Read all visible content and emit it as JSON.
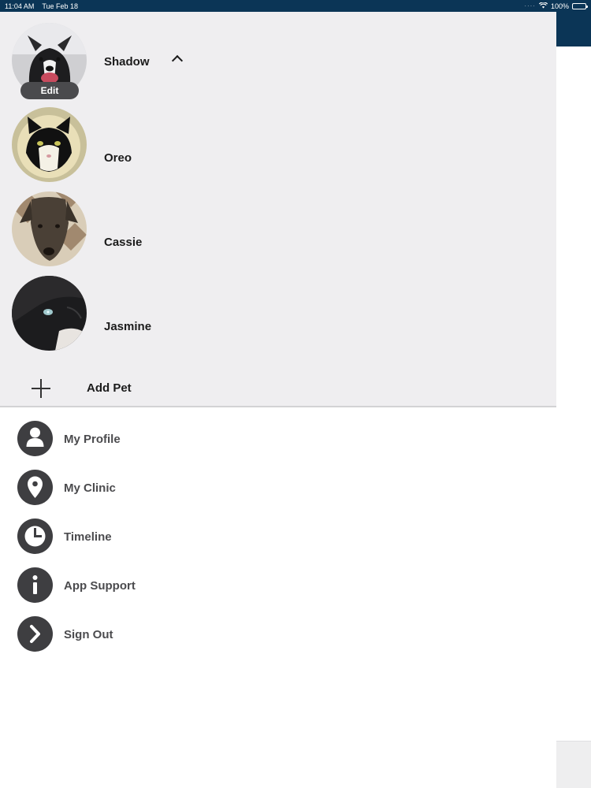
{
  "status_bar": {
    "time": "11:04 AM",
    "date": "Tue Feb 18",
    "battery": "100%",
    "icons": [
      "cellular-dots-icon",
      "wifi-icon",
      "battery-icon"
    ]
  },
  "pets": {
    "items": [
      {
        "name": "Shadow",
        "expanded": true,
        "edit_label": "Edit"
      },
      {
        "name": "Oreo"
      },
      {
        "name": "Cassie"
      },
      {
        "name": "Jasmine"
      }
    ],
    "add_label": "Add Pet"
  },
  "menu": {
    "items": [
      {
        "label": "My Profile",
        "icon": "person-icon"
      },
      {
        "label": "My Clinic",
        "icon": "location-pin-icon"
      },
      {
        "label": "Timeline",
        "icon": "clock-icon"
      },
      {
        "label": "App Support",
        "icon": "info-icon"
      },
      {
        "label": "Sign Out",
        "icon": "chevron-right-icon"
      }
    ]
  },
  "colors": {
    "header": "#0b3556",
    "drawer_bg": "#efeef0",
    "icon_bg": "#3e3e41",
    "text": "#1b1b1b"
  }
}
